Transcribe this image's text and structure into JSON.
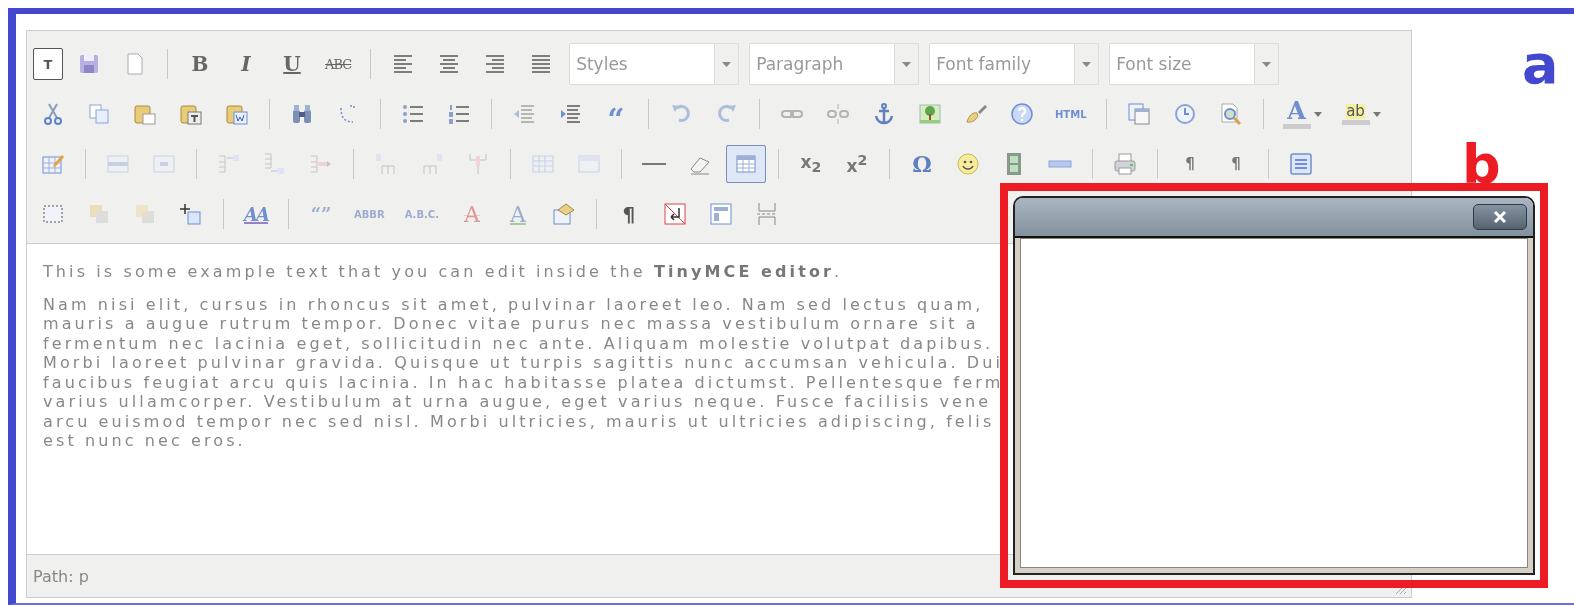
{
  "annotations": [
    {
      "label": "a",
      "color": "#4348cf"
    },
    {
      "label": "b",
      "color": "#ed1c24"
    }
  ],
  "toolbar": {
    "rows": [
      {
        "items": [
          {
            "kind": "text",
            "label": "T",
            "disabled": false,
            "pressed": true
          },
          {
            "kind": "icon",
            "disabled": false,
            "pressed": false
          },
          {
            "kind": "icon",
            "disabled": false,
            "pressed": false
          },
          {
            "kind": "separator"
          },
          {
            "kind": "text",
            "label": "B",
            "disabled": false,
            "pressed": false
          },
          {
            "kind": "text",
            "label": "I",
            "disabled": false,
            "pressed": false
          },
          {
            "kind": "text",
            "label": "U",
            "disabled": false,
            "pressed": false
          },
          {
            "kind": "text",
            "label": "ABC",
            "disabled": false,
            "pressed": false
          },
          {
            "kind": "separator"
          },
          {
            "kind": "icon",
            "disabled": false,
            "pressed": false
          },
          {
            "kind": "icon",
            "disabled": false,
            "pressed": false
          },
          {
            "kind": "icon",
            "disabled": false,
            "pressed": false
          },
          {
            "kind": "icon",
            "disabled": false,
            "pressed": false
          },
          {
            "kind": "select",
            "label": "Styles"
          },
          {
            "kind": "select",
            "label": "Paragraph"
          },
          {
            "kind": "select",
            "label": "Font family"
          },
          {
            "kind": "select",
            "label": "Font size"
          }
        ]
      },
      {
        "items": [
          {
            "kind": "icon",
            "disabled": false,
            "pressed": false
          },
          {
            "kind": "icon",
            "disabled": false,
            "pressed": false
          },
          {
            "kind": "icon",
            "disabled": false,
            "pressed": false
          },
          {
            "kind": "icon",
            "disabled": false,
            "pressed": false
          },
          {
            "kind": "icon",
            "disabled": false,
            "pressed": false
          },
          {
            "kind": "separator"
          },
          {
            "kind": "icon",
            "disabled": false,
            "pressed": false
          },
          {
            "kind": "icon",
            "disabled": false,
            "pressed": false
          },
          {
            "kind": "separator"
          },
          {
            "kind": "icon",
            "disabled": false,
            "pressed": false
          },
          {
            "kind": "icon",
            "disabled": false,
            "pressed": false
          },
          {
            "kind": "separator"
          },
          {
            "kind": "icon",
            "disabled": true,
            "pressed": false
          },
          {
            "kind": "icon",
            "disabled": false,
            "pressed": false
          },
          {
            "kind": "text",
            "label": "“",
            "disabled": false,
            "pressed": false
          },
          {
            "kind": "separator"
          },
          {
            "kind": "icon",
            "disabled": true,
            "pressed": false
          },
          {
            "kind": "icon",
            "disabled": true,
            "pressed": false
          },
          {
            "kind": "separator"
          },
          {
            "kind": "icon",
            "disabled": true,
            "pressed": false
          },
          {
            "kind": "icon",
            "disabled": true,
            "pressed": false
          },
          {
            "kind": "icon",
            "disabled": false,
            "pressed": false
          },
          {
            "kind": "icon",
            "disabled": false,
            "pressed": false
          },
          {
            "kind": "icon",
            "disabled": false,
            "pressed": false
          },
          {
            "kind": "icon",
            "disabled": false,
            "pressed": false
          },
          {
            "kind": "text",
            "label": "HTML",
            "disabled": false,
            "pressed": false
          },
          {
            "kind": "separator"
          },
          {
            "kind": "icon",
            "disabled": false,
            "pressed": false
          },
          {
            "kind": "icon",
            "disabled": false,
            "pressed": false
          },
          {
            "kind": "icon",
            "disabled": false,
            "pressed": false
          },
          {
            "kind": "separator"
          },
          {
            "kind": "color",
            "label": "A",
            "disabled": false,
            "pressed": false
          },
          {
            "kind": "color",
            "label": "ab",
            "disabled": false,
            "pressed": false
          }
        ]
      },
      {
        "items": [
          {
            "kind": "icon",
            "disabled": false,
            "pressed": false
          },
          {
            "kind": "separator"
          },
          {
            "kind": "icon",
            "disabled": true,
            "pressed": false
          },
          {
            "kind": "icon",
            "disabled": true,
            "pressed": false
          },
          {
            "kind": "separator"
          },
          {
            "kind": "icon",
            "disabled": true,
            "pressed": false
          },
          {
            "kind": "icon",
            "disabled": true,
            "pressed": false
          },
          {
            "kind": "icon",
            "disabled": true,
            "pressed": false
          },
          {
            "kind": "separator"
          },
          {
            "kind": "icon",
            "disabled": true,
            "pressed": false
          },
          {
            "kind": "icon",
            "disabled": true,
            "pressed": false
          },
          {
            "kind": "icon",
            "disabled": true,
            "pressed": false
          },
          {
            "kind": "separator"
          },
          {
            "kind": "icon",
            "disabled": true,
            "pressed": false
          },
          {
            "kind": "icon",
            "disabled": true,
            "pressed": false
          },
          {
            "kind": "separator"
          },
          {
            "kind": "icon",
            "disabled": false,
            "pressed": false
          },
          {
            "kind": "icon",
            "disabled": false,
            "pressed": false
          },
          {
            "kind": "icon",
            "disabled": false,
            "pressed": true
          },
          {
            "kind": "separator"
          },
          {
            "kind": "text",
            "label": "x$_{2}$",
            "disabled": false,
            "pressed": false
          },
          {
            "kind": "text",
            "label": "x$^{2}$",
            "disabled": false,
            "pressed": false
          },
          {
            "kind": "separator"
          },
          {
            "kind": "text",
            "label": "Ω",
            "disabled": false,
            "pressed": false
          },
          {
            "kind": "icon",
            "disabled": false,
            "pressed": false
          },
          {
            "kind": "icon",
            "disabled": false,
            "pressed": false
          },
          {
            "kind": "icon",
            "disabled": false,
            "pressed": false
          },
          {
            "kind": "separator"
          },
          {
            "kind": "icon",
            "disabled": false,
            "pressed": false
          },
          {
            "kind": "separator"
          },
          {
            "kind": "text",
            "label": "¶",
            "disabled": false,
            "pressed": false
          },
          {
            "kind": "text",
            "label": "¶",
            "disabled": false,
            "pressed": false
          },
          {
            "kind": "separator"
          },
          {
            "kind": "icon",
            "disabled": false,
            "pressed": false
          }
        ]
      },
      {
        "items": [
          {
            "kind": "icon",
            "disabled": false,
            "pressed": false
          },
          {
            "kind": "icon",
            "disabled": true,
            "pressed": false
          },
          {
            "kind": "icon",
            "disabled": true,
            "pressed": false
          },
          {
            "kind": "icon",
            "disabled": false,
            "pressed": false
          },
          {
            "kind": "separator"
          },
          {
            "kind": "text",
            "label": "AA",
            "disabled": false,
            "pressed": false
          },
          {
            "kind": "separator"
          },
          {
            "kind": "text",
            "label": "“”",
            "disabled": true,
            "pressed": false
          },
          {
            "kind": "text",
            "label": "ABBR",
            "disabled": true,
            "pressed": false
          },
          {
            "kind": "text",
            "label": "A.B.C.",
            "disabled": true,
            "pressed": false
          },
          {
            "kind": "text",
            "label": "A",
            "disabled": true,
            "pressed": false
          },
          {
            "kind": "text",
            "label": "A",
            "disabled": true,
            "pressed": false
          },
          {
            "kind": "icon",
            "disabled": false,
            "pressed": false
          },
          {
            "kind": "separator"
          },
          {
            "kind": "text",
            "label": "¶",
            "disabled": false,
            "pressed": false
          },
          {
            "kind": "icon",
            "disabled": false,
            "pressed": false
          },
          {
            "kind": "icon",
            "disabled": false,
            "pressed": false
          },
          {
            "kind": "icon",
            "disabled": false,
            "pressed": false
          }
        ]
      }
    ]
  },
  "content": {
    "intro": "This is some example text that you can edit inside the **TinyMCE editor**.",
    "paragraph_lines": [
      "Nam nisi elit, cursus in rhoncus sit amet, pulvinar laoreet leo. Nam sed lectus quam,",
      "mauris a augue rutrum tempor. Donec vitae purus nec massa vestibulum ornare sit a",
      "fermentum nec lacinia eget, sollicitudin nec ante. Aliquam molestie volutpat dapibus.",
      "Morbi laoreet pulvinar gravida. Quisque ut turpis sagittis nunc accumsan vehicula. Dui",
      "faucibus feugiat arcu quis lacinia. In hac habitasse platea dictumst. Pellentesque ferm",
      "varius ullamcorper. Vestibulum at urna augue, eget varius neque. Fusce facilisis vene",
      "arcu euismod tempor nec sed nisl. Morbi ultricies, mauris ut ultricies adipiscing, felis",
      "est nunc nec eros."
    ]
  },
  "status_bar": {
    "path": "Path: p"
  }
}
